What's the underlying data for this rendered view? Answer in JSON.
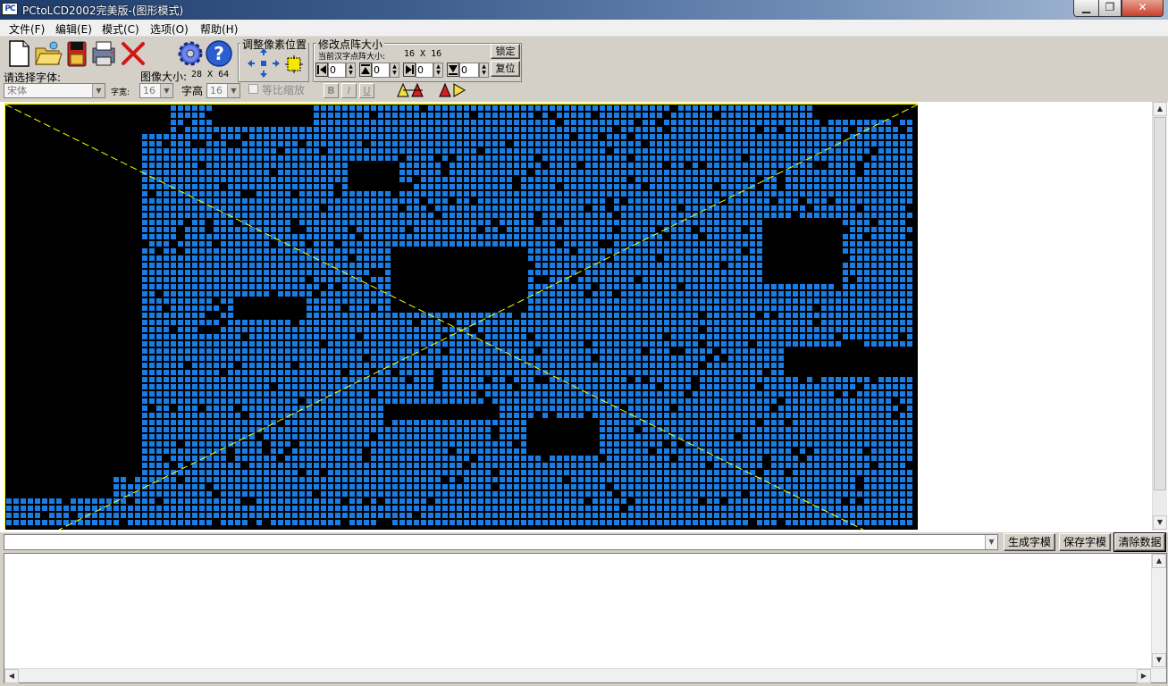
{
  "window": {
    "title": "PCtoLCD2002完美版-(图形模式)",
    "minimize": "▁",
    "maximize": "❐",
    "close": "✕"
  },
  "menu": [
    "文件(F)",
    "编辑(E)",
    "模式(C)",
    "选项(O)",
    "帮助(H)"
  ],
  "toolbar": {
    "icons": [
      "new-file-icon",
      "open-folder-icon",
      "save-icon",
      "print-icon",
      "delete-icon",
      "settings-gear-icon",
      "help-icon"
    ],
    "adjust_pixel_label": "调整像素位置",
    "modify_matrix_label": "修改点阵大小",
    "current_size_label": "当前汉字点阵大小:",
    "current_size_value": "16 X 16",
    "lock_button": "锁定",
    "reset_button": "复位",
    "spin_values": [
      "0",
      "0",
      "0",
      "0"
    ],
    "image_size_label": "图像大小:",
    "image_size_value": "28 X 64",
    "font_select_label": "请选择字体:",
    "font_value": "宋体",
    "char_width_label": "字宽:",
    "char_width_value": "16",
    "char_height_label": "字高",
    "char_height_value": "16",
    "proportional_label": "等比缩放",
    "format_buttons": [
      "B",
      "I",
      "U"
    ]
  },
  "bottom": {
    "generate_button": "生成字模",
    "save_button": "保存字模",
    "clear_button": "清除数据"
  },
  "colors": {
    "pixel_on": "#1a7de6",
    "pixel_off": "#000000",
    "guide_line": "#ffff00",
    "background_face": "#d4d0c8"
  }
}
